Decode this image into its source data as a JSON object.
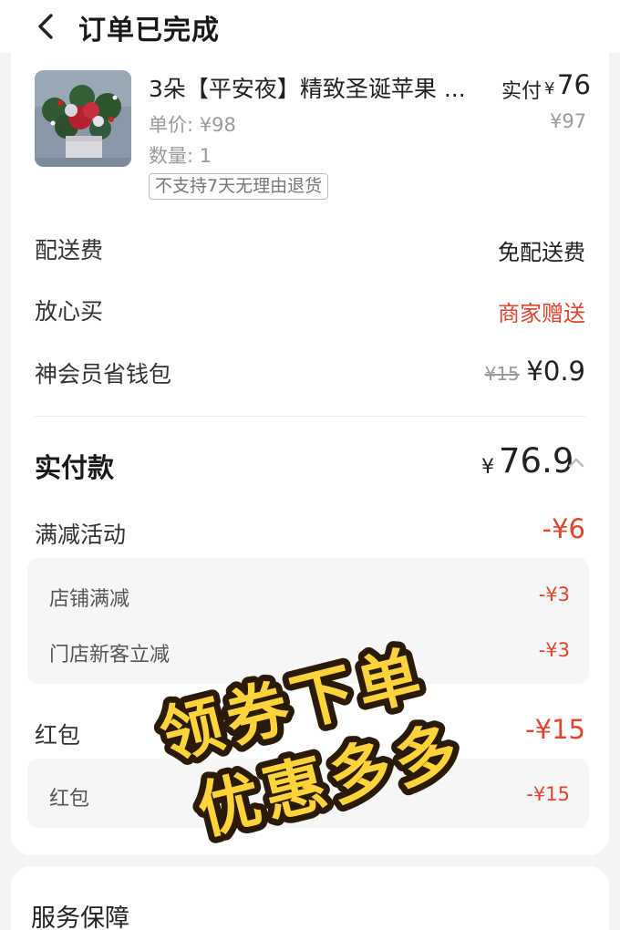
{
  "header": {
    "title": "订单已完成"
  },
  "product": {
    "name": "3朵【平安夜】精致圣诞苹果 ...",
    "paid_label": "实付",
    "paid_currency": "¥",
    "paid_value": "76",
    "unit_price": "单价: ¥98",
    "original_price": "¥97",
    "quantity": "数量: 1",
    "return_policy_tag": "不支持7天无理由退货"
  },
  "fees": {
    "delivery_label": "配送费",
    "delivery_value": "免配送费",
    "assurance_label": "放心买",
    "assurance_value": "商家赠送",
    "member_label": "神会员省钱包",
    "member_original": "¥15",
    "member_value": "¥0.9"
  },
  "total": {
    "label": "实付款",
    "currency": "¥",
    "value": "76.9"
  },
  "discounts": {
    "full_reduction_label": "满减活动",
    "full_reduction_value": "-¥6",
    "items": [
      {
        "label": "店铺满减",
        "value": "-¥3"
      },
      {
        "label": "门店新客立减",
        "value": "-¥3"
      }
    ],
    "red_packet_label": "红包",
    "red_packet_value": "-¥15",
    "red_packet_items": [
      {
        "label": "红包",
        "value": "-¥15"
      }
    ]
  },
  "promo_overlay": {
    "line1": "领券下单",
    "line2": "优惠多多"
  },
  "service": {
    "title": "服务保障"
  },
  "colors": {
    "accent_red": "#e0442e",
    "promo_yellow": "#ffd43b",
    "promo_outline": "#2a1a08"
  }
}
